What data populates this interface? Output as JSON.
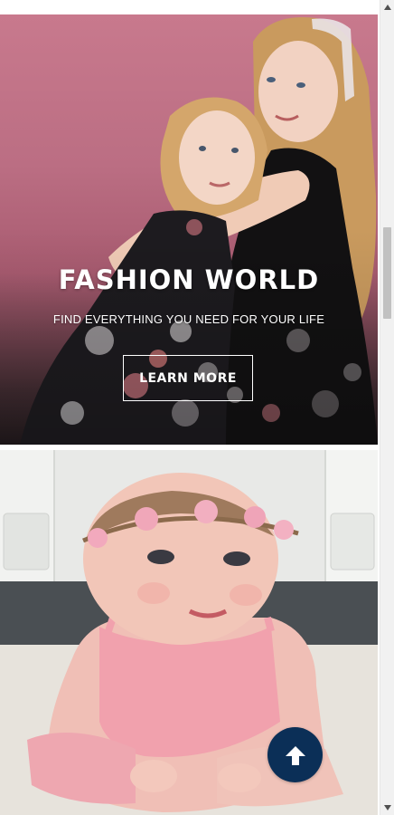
{
  "hero": {
    "title": "FASHION WORLD",
    "subtitle": "FIND EVERYTHING YOU NEED FOR YOUR LIFE",
    "cta_label": "LEARN MORE"
  },
  "colors": {
    "hero_background": "#c8798d",
    "cta_border": "#ffffff",
    "back_to_top": "#0b2f57",
    "scroll_track": "#f1f1f1",
    "scroll_thumb": "#c1c1c1"
  },
  "icons": {
    "back_to_top": "arrow-up-icon",
    "scroll_up": "triangle-up-icon",
    "scroll_down": "triangle-down-icon"
  }
}
